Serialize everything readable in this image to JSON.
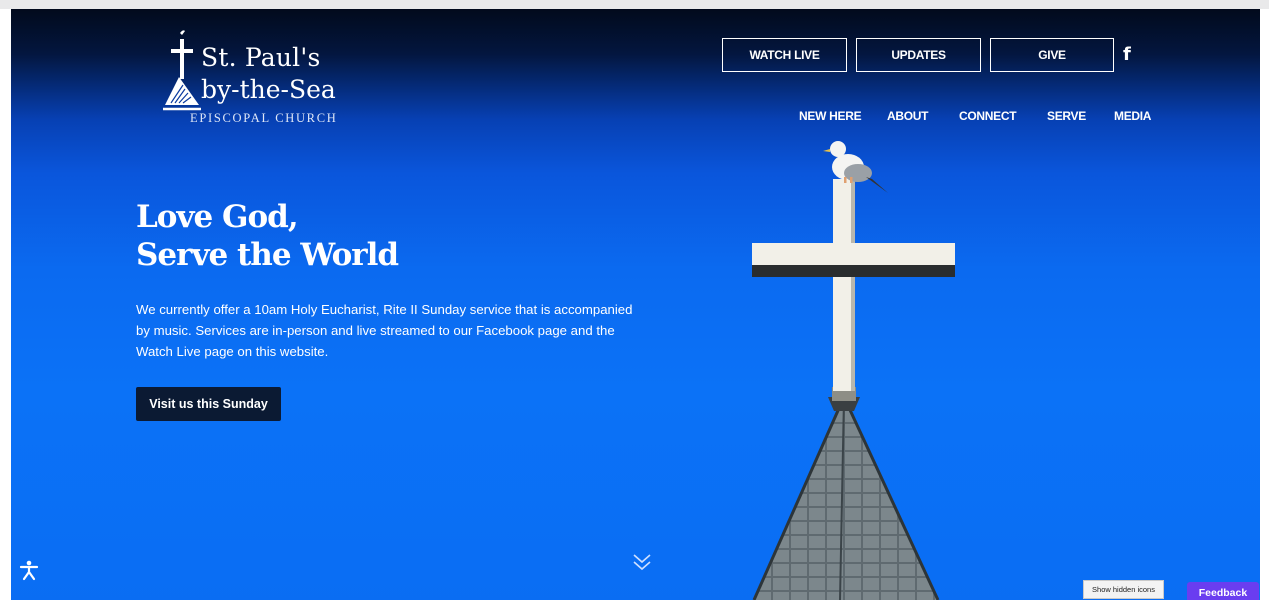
{
  "logo": {
    "line1": "St. Paul's",
    "line2": "by-the-Sea",
    "tagline": "EPISCOPAL CHURCH"
  },
  "header_buttons": {
    "watch_live": "WATCH LIVE",
    "updates": "UPDATES",
    "give": "GIVE",
    "facebook": "f"
  },
  "nav": [
    "NEW HERE",
    "ABOUT",
    "CONNECT",
    "SERVE",
    "MEDIA"
  ],
  "hero": {
    "headline_line1": "Love God,",
    "headline_line2": "Serve the World",
    "intro": "We currently offer a 10am Holy Eucharist, Rite II Sunday service that is accompanied by music. Services are in-person and live streamed to our Facebook page and the Watch Live page on this website.",
    "cta": "Visit us this Sunday"
  },
  "system": {
    "hidden_icons": "Show hidden icons",
    "feedback": "Feedback"
  },
  "icons": {
    "scroll": "double-chevron-down-icon",
    "accessibility": "accessibility-icon",
    "logo_mark": "cross-and-sail-icon"
  },
  "colors": {
    "sky": "#0b72f7",
    "sky_dark": "#020a1c",
    "cta_bg": "#0b1a33",
    "feedback_bg": "#6a3df0"
  }
}
